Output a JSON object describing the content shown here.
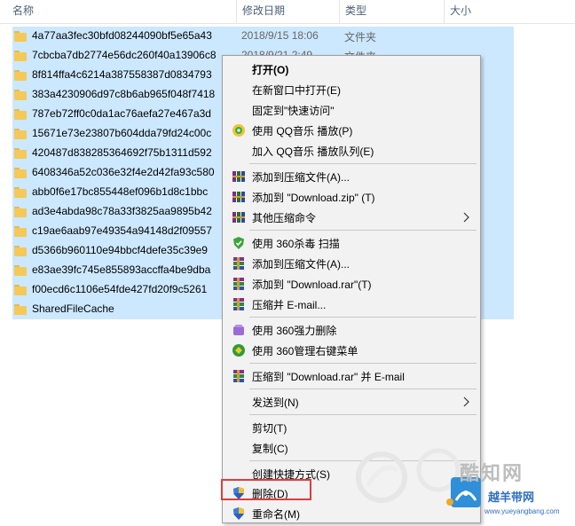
{
  "header": {
    "col_name": "名称",
    "col_date": "修改日期",
    "col_type": "类型",
    "col_size": "大小"
  },
  "files": [
    {
      "name": "4a77aa3fec30bfd08244090bf5e65a43",
      "date": "2018/9/15 18:06",
      "type": "文件夹"
    },
    {
      "name": "7cbcba7db2774e56dc260f40a13906c8",
      "date": "2018/9/21 2:49",
      "type": "文件夹"
    },
    {
      "name": "8f814ffa4c6214a387558387d0834793",
      "date": "",
      "type": ""
    },
    {
      "name": "383a4230906d97c8b6ab965f048f7418",
      "date": "",
      "type": ""
    },
    {
      "name": "787eb72ff0c0da1ac76aefa27e467a3d",
      "date": "",
      "type": ""
    },
    {
      "name": "15671e73e23807b604dda79fd24c00c",
      "date": "",
      "type": ""
    },
    {
      "name": "420487d838285364692f75b1311d592",
      "date": "",
      "type": ""
    },
    {
      "name": "6408346a52c036e32f4e2d42fa93c580",
      "date": "",
      "type": ""
    },
    {
      "name": "abb0f6e17bc855448ef096b1d8c1bbc",
      "date": "",
      "type": ""
    },
    {
      "name": "ad3e4abda98c78a33f3825aa9895b42",
      "date": "",
      "type": ""
    },
    {
      "name": "c19ae6aab97e49354a94148d2f09557",
      "date": "",
      "type": ""
    },
    {
      "name": "d5366b960110e94bbcf4defe35c39e9",
      "date": "",
      "type": ""
    },
    {
      "name": "e83ae39fc745e855893accffa4be9dba",
      "date": "",
      "type": ""
    },
    {
      "name": "f00ecd6c1106e54fde427fd20f9c5261",
      "date": "",
      "type": ""
    },
    {
      "name": "SharedFileCache",
      "date": "",
      "type": ""
    }
  ],
  "menu": {
    "open": "打开(O)",
    "open_new_window": "在新窗口中打开(E)",
    "pin_quick_access": "固定到\"快速访问\"",
    "qq_play": "使用 QQ音乐 播放(P)",
    "qq_queue": "加入 QQ音乐 播放队列(E)",
    "add_archive_1": "添加到压缩文件(A)...",
    "add_zip": "添加到 \"Download.zip\" (T)",
    "other_compress": "其他压缩命令",
    "scan_360": "使用 360杀毒 扫描",
    "add_archive_2": "添加到压缩文件(A)...",
    "add_rar": "添加到 \"Download.rar\"(T)",
    "compress_email": "压缩并 E-mail...",
    "force_delete_360": "使用 360强力删除",
    "manage_menu_360": "使用 360管理右键菜单",
    "compress_rar_email": "压缩到 \"Download.rar\" 并 E-mail",
    "send_to": "发送到(N)",
    "cut": "剪切(T)",
    "copy": "复制(C)",
    "create_shortcut": "创建快捷方式(S)",
    "delete": "删除(D)",
    "rename": "重命名(M)"
  },
  "watermark": {
    "brand": "酷知网",
    "brand2": "越羊带网",
    "url": "www.yueyangbang.com"
  },
  "colors": {
    "selection": "#cce8ff",
    "menu_bg": "#f2f2f2",
    "highlight_border": "#e03c3c"
  }
}
